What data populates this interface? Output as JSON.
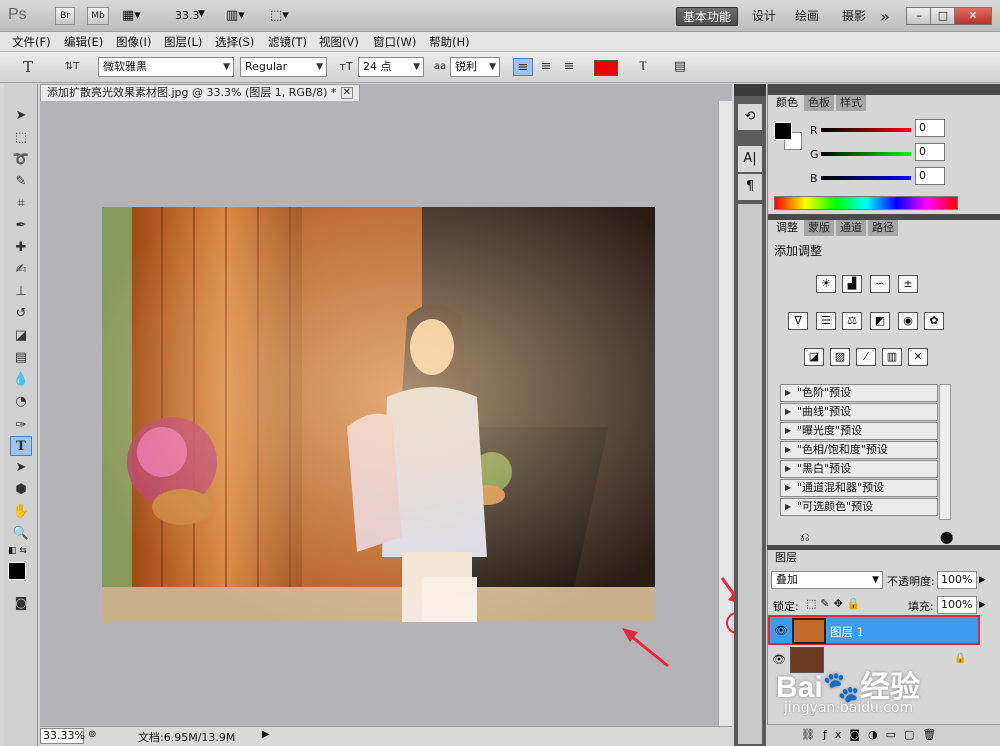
{
  "titlebar": {
    "logo": "Ps",
    "br": "Br",
    "mb": "Mb",
    "zoom": "33.3",
    "workspaces": [
      "基本功能",
      "设计",
      "绘画",
      "摄影"
    ],
    "more": "»",
    "win_min": "–",
    "win_restore": "□",
    "win_close": "✕"
  },
  "menu": [
    "文件(F)",
    "编辑(E)",
    "图像(I)",
    "图层(L)",
    "选择(S)",
    "滤镜(T)",
    "视图(V)",
    "窗口(W)",
    "帮助(H)"
  ],
  "options": {
    "tool_icon": "T",
    "orient_icon": "⇅T",
    "font_family": "微软雅黑",
    "font_style": "Regular",
    "font_size": "24 点",
    "aa_label": "aa",
    "antialias": "锐利",
    "text_color": "#ee0000"
  },
  "document": {
    "tab_title": "添加扩散亮光效果素材图.jpg @ 33.3% (图层 1, RGB/8) *",
    "zoom_status": "33.33%",
    "doc_status": "文档:6.95M/13.9M"
  },
  "color_panel": {
    "tabs": [
      "颜色",
      "色板",
      "样式"
    ],
    "r_label": "R",
    "g_label": "G",
    "b_label": "B",
    "r": "0",
    "g": "0",
    "b": "0"
  },
  "adjust_panel": {
    "tabs": [
      "调整",
      "蒙版",
      "通道",
      "路径"
    ],
    "heading": "添加调整",
    "presets": [
      "\"色阶\"预设",
      "\"曲线\"预设",
      "\"曝光度\"预设",
      "\"色相/饱和度\"预设",
      "\"黑白\"预设",
      "\"通道混和器\"预设",
      "\"可选颜色\"预设"
    ]
  },
  "layers_panel": {
    "tab": "图层",
    "blend_mode": "叠加",
    "opacity_label": "不透明度:",
    "opacity": "100%",
    "lock_label": "锁定:",
    "fill_label": "填充:",
    "fill": "100%",
    "layers": [
      {
        "name": "图层 1",
        "selected": true
      },
      {
        "name": "",
        "selected": false
      }
    ]
  },
  "watermark": {
    "brand": "Bai",
    "brand2": "经验",
    "url": "jingyan.baidu.com"
  },
  "colors": {
    "accent_selection": "#3d9cf0",
    "annotation_red": "#e8283a"
  }
}
